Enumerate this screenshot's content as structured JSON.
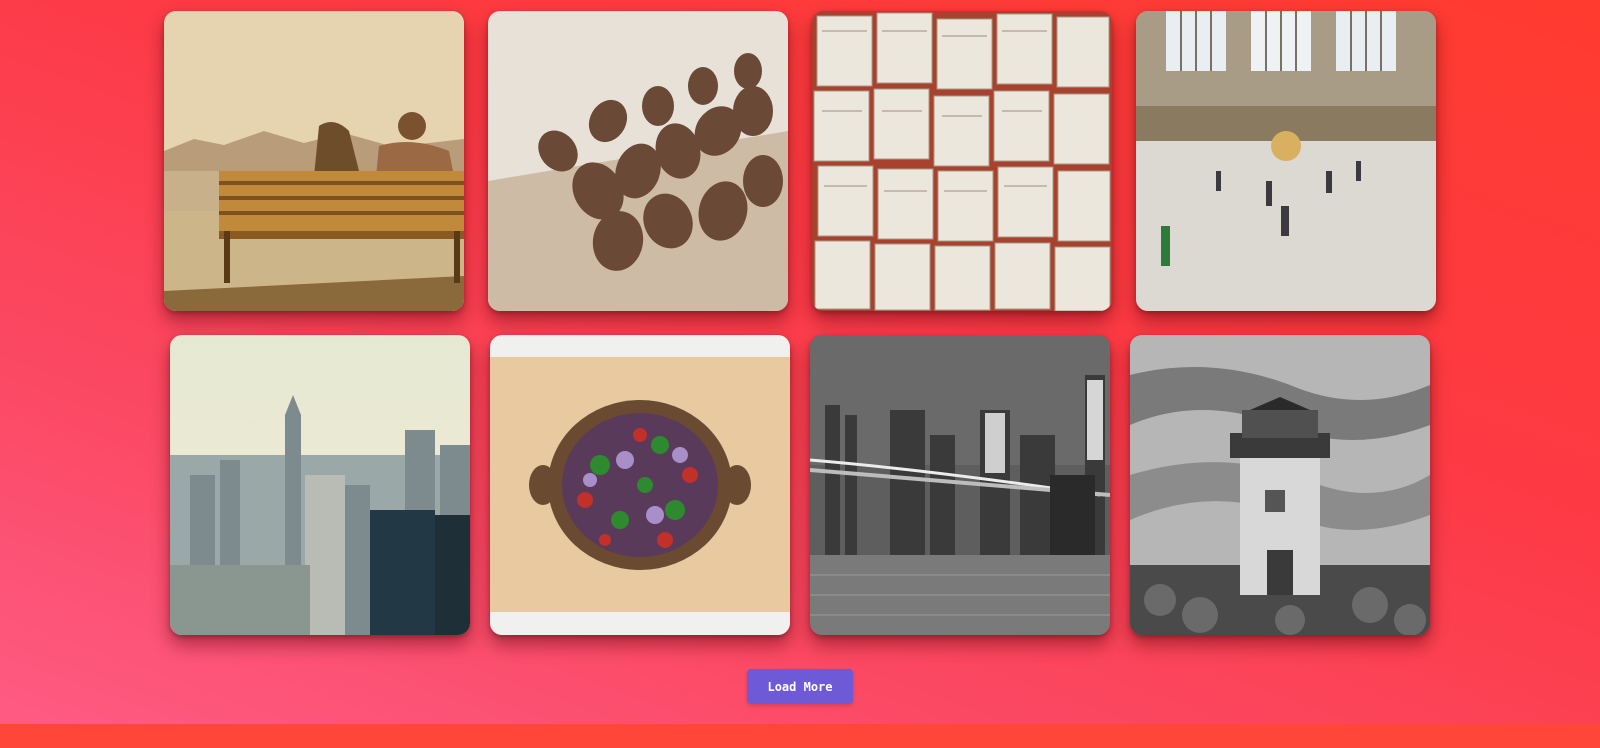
{
  "gallery": {
    "images": [
      {
        "subject": "couple-on-bench-photo"
      },
      {
        "subject": "coffee-beans-photo"
      },
      {
        "subject": "open-books-photo"
      },
      {
        "subject": "grand-central-station-photo"
      },
      {
        "subject": "new-york-skyline-photo"
      },
      {
        "subject": "salad-bowl-photo"
      },
      {
        "subject": "brooklyn-bridge-night-photo"
      },
      {
        "subject": "lighthouse-photo"
      }
    ]
  },
  "actions": {
    "load_more_label": "Load More"
  },
  "colors": {
    "background_top": "#ff3b2f",
    "background_bottom": "#fe5c86",
    "button": "#6e5ad6",
    "footer": "#ff4638"
  }
}
